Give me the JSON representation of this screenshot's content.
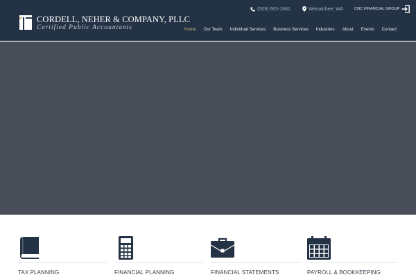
{
  "brand": {
    "name": "CORDELL, NEHER & COMPANY, PLLC",
    "tagline": "Certified Public Accountants"
  },
  "contact": {
    "phone": "(509) 663-1661",
    "location": "Wenatchee, WA",
    "group_link": "CNC FINANCIAL GROUP"
  },
  "nav": {
    "items": [
      "Home",
      "Our Team",
      "Individual Services",
      "Business Services",
      "Industries",
      "About",
      "Events",
      "Contact"
    ],
    "active": "Home"
  },
  "services": [
    {
      "label": "TAX PLANNING",
      "icon": "book-icon"
    },
    {
      "label": "FINANCIAL PLANNING",
      "icon": "calculator-icon"
    },
    {
      "label": "FINANCIAL STATEMENTS",
      "icon": "briefcase-icon"
    },
    {
      "label": "PAYROLL & BOOKKEEPING",
      "icon": "calendar-icon"
    }
  ],
  "colors": {
    "header": "#233244",
    "hero": "#484d57",
    "icon": "#233244",
    "active_nav": "#c8b878"
  }
}
